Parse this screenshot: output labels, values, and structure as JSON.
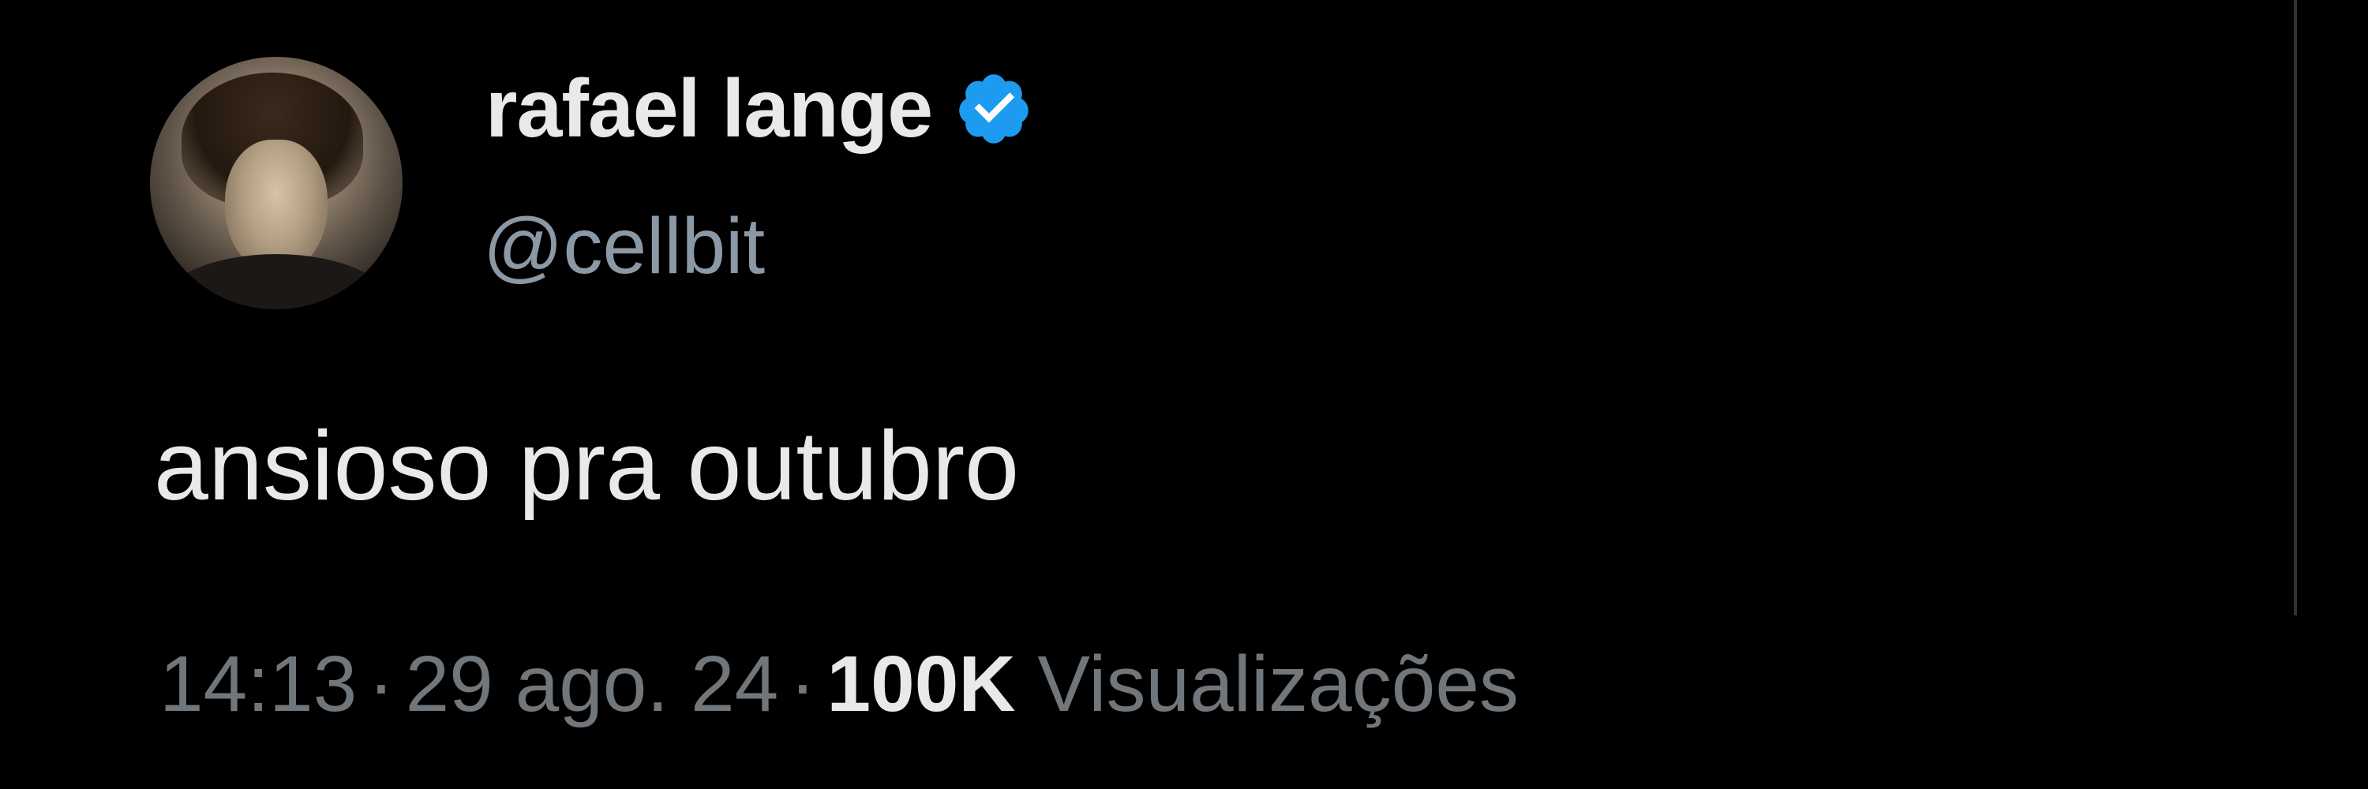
{
  "tweet": {
    "author": {
      "display_name": "rafael lange",
      "handle": "@cellbit",
      "verified_icon": "verified-badge-icon",
      "verified_color": "#1d9bf0"
    },
    "text": "ansioso pra outubro",
    "meta": {
      "time": "14:13",
      "separator": "·",
      "date": "29 ago. 24",
      "views_count": "100K",
      "views_label": "Visualizações"
    }
  },
  "colors": {
    "background": "#000000",
    "primary_text": "#e7e9ea",
    "secondary_text": "#71767b",
    "handle_text": "#8b98a5",
    "accent": "#1d9bf0"
  }
}
